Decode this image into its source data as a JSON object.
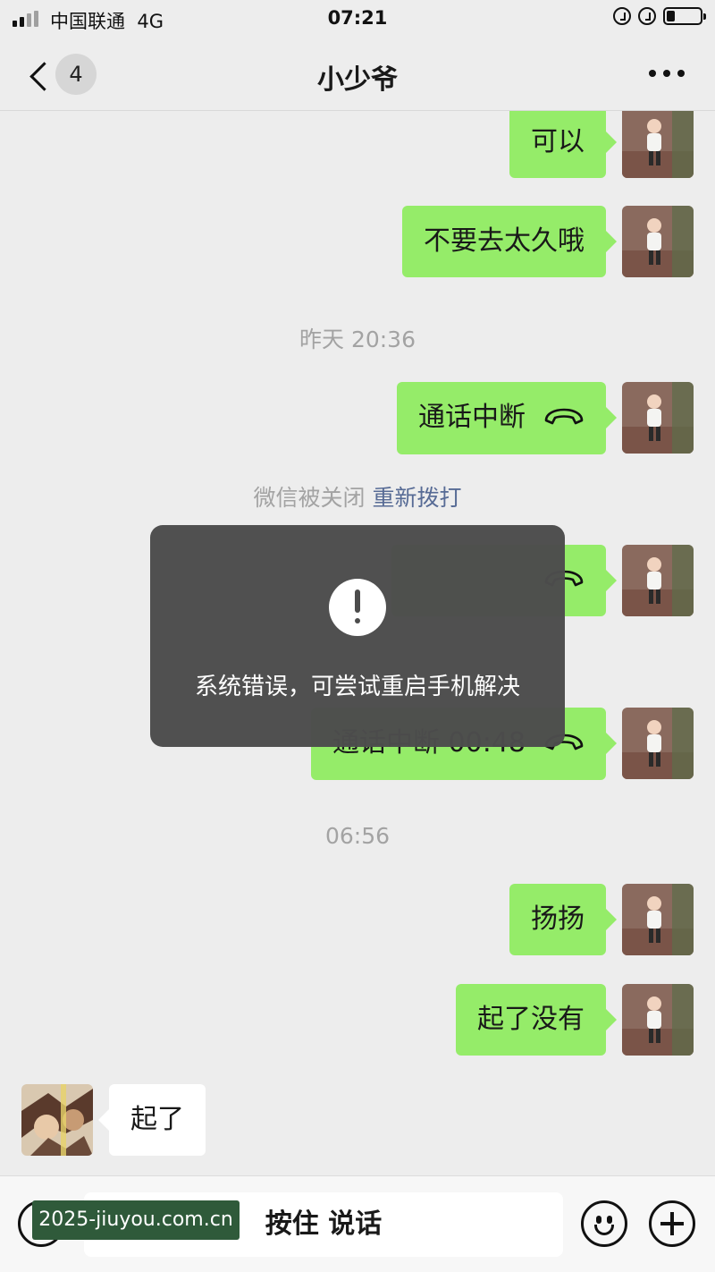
{
  "status_bar": {
    "carrier": "中国联通",
    "network": "4G",
    "time": "07:21",
    "battery_level": 0.25
  },
  "nav": {
    "back_icon": "chevron-left-icon",
    "unread_count": "4",
    "title": "小少爷",
    "more_icon": "more-dots-icon"
  },
  "messages": [
    {
      "side": "me",
      "text": "可以"
    },
    {
      "side": "me",
      "text": "不要去太久哦"
    },
    {
      "type": "time",
      "text": "昨天 20:36"
    },
    {
      "side": "me",
      "text": "通话中断",
      "icon": "phone-hangup-icon"
    },
    {
      "type": "system",
      "text": "微信被关闭",
      "link": "重新拨打"
    },
    {
      "side": "me",
      "text": "",
      "icon": "phone-hangup-icon"
    },
    {
      "side": "me",
      "text": "通话中断 00:48",
      "icon": "phone-hangup-icon"
    },
    {
      "type": "time",
      "text": "06:56"
    },
    {
      "side": "me",
      "text": "扬扬"
    },
    {
      "side": "me",
      "text": "起了没有"
    },
    {
      "side": "other",
      "text": "起了"
    }
  ],
  "toast": {
    "icon": "exclamation-icon",
    "text": "系统错误，可尝试重启手机解决"
  },
  "input_bar": {
    "voice_icon": "voice-icon",
    "hold_to_talk": "按住 说话",
    "emoji_icon": "emoji-icon",
    "plus_icon": "plus-icon"
  },
  "watermark": "2025-jiuyou.com.cn",
  "colors": {
    "my_bubble": "#95ec69",
    "other_bubble": "#ffffff",
    "background": "#ededed",
    "link": "#576b95",
    "toast_bg": "#4c4c4c"
  }
}
